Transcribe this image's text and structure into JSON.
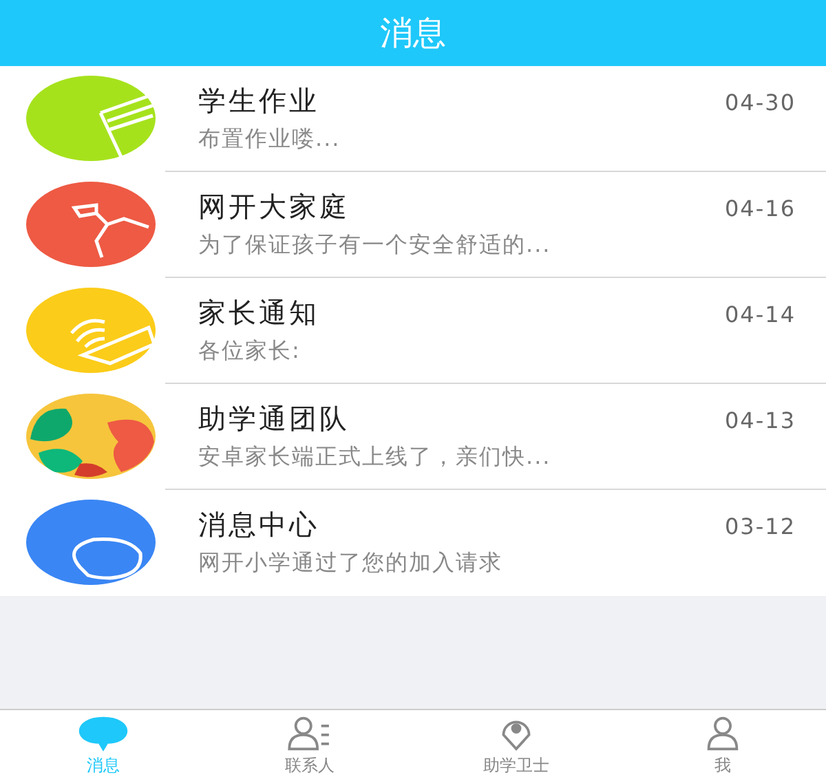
{
  "header": {
    "title": "消息"
  },
  "messages": [
    {
      "kind": "homework",
      "color": "#a6e21c",
      "title": "学生作业",
      "date": "04-30",
      "preview": "布置作业喽..."
    },
    {
      "kind": "family",
      "color": "#ee5a44",
      "title": "网开大家庭",
      "date": "04-16",
      "preview": "为了保证孩子有一个安全舒适的..."
    },
    {
      "kind": "notice",
      "color": "#fbcc19",
      "title": "家长通知",
      "date": "04-14",
      "preview": "各位家长:"
    },
    {
      "kind": "team",
      "color": "#f6c53c",
      "title": "助学通团队",
      "date": "04-13",
      "preview": "安卓家长端正式上线了，亲们快..."
    },
    {
      "kind": "center",
      "color": "#3a86f4",
      "title": "消息中心",
      "date": "03-12",
      "preview": "网开小学通过了您的加入请求"
    }
  ],
  "tabs": [
    {
      "kind": "chat",
      "label": "消息",
      "selected": true
    },
    {
      "kind": "contacts",
      "label": "联系人",
      "selected": false
    },
    {
      "kind": "location",
      "label": "助学卫士",
      "selected": false
    },
    {
      "kind": "me",
      "label": "我",
      "selected": false
    }
  ]
}
